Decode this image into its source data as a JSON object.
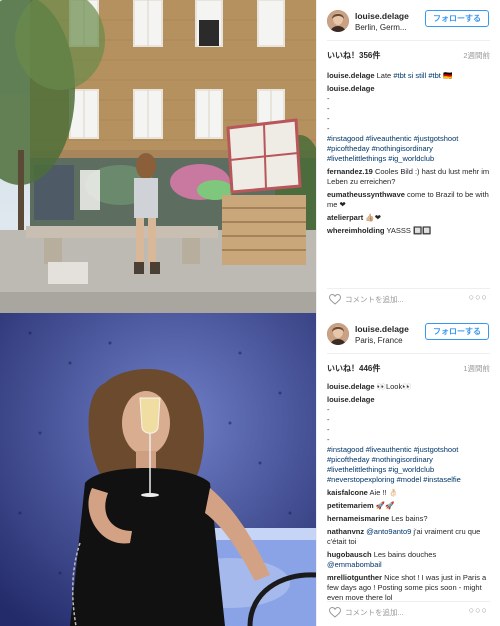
{
  "posts": [
    {
      "username": "louise.delage",
      "location": "Berlin, Germ...",
      "follow_label": "フォローする",
      "likes": "いいね！356件",
      "time_ago": "2週間前",
      "caption_user": "louise.delage",
      "caption_pre": "Late ",
      "caption_tags": "#tbt si still #tbt",
      "caption_flag": "🇩🇪",
      "comment2_user": "louise.delage",
      "dash_lines": [
        "-",
        "-",
        "-",
        "-"
      ],
      "hashtag_lines": [
        "#instagood #liveauthentic #justgotshoot",
        "#picoftheday #nothingisordinary",
        "#livethelittlethings #ig_worldclub"
      ],
      "comments": [
        {
          "user": "fernandez.19",
          "text": "Cooles Bild :) hast du lust mehr im Leben zu erreichen?"
        },
        {
          "user": "eumatheussynthwave",
          "text": "come to Brazil to be with me ❤"
        },
        {
          "user": "atelierpart",
          "text": "👍🏼❤"
        },
        {
          "user": "whereimholding",
          "text": "YASSS 🔲🔲"
        }
      ],
      "add_comment": "コメントを追加...",
      "more": "○○○"
    },
    {
      "username": "louise.delage",
      "location": "Paris, France",
      "follow_label": "フォローする",
      "likes": "いいね！446件",
      "time_ago": "1週間前",
      "caption_user": "louise.delage",
      "caption_text": "👀Look👀",
      "comment2_user": "louise.delage",
      "dash_lines": [
        "-",
        "-",
        "-",
        "-"
      ],
      "hashtag_lines": [
        "#instagood #liveauthentic #justgotshoot",
        "#picoftheday #nothingisordinary",
        "#livethelittlethings #ig_worldclub",
        "#neverstopexploring #model #instaselfie"
      ],
      "comments": [
        {
          "user": "kaisfalcone",
          "text": "Aie !! 👌🏻"
        },
        {
          "user": "petitemariem",
          "text": "🚀🚀"
        },
        {
          "user": "hernameismarine",
          "text": "Les bains?"
        },
        {
          "user": "nathanvnz",
          "mention": "@anto9anto9",
          "text": " j'ai vraiment cru que c'était toi"
        },
        {
          "user": "hugobausch",
          "text": "Les bains douches",
          "mention2": "@emmabombail"
        },
        {
          "user": "mrelliotgunther",
          "text": "Nice shot ! I was just in Paris a few days ago ! Posting some pics soon - might even move there lol"
        }
      ],
      "add_comment": "コメントを追加...",
      "more": "○○○"
    }
  ]
}
